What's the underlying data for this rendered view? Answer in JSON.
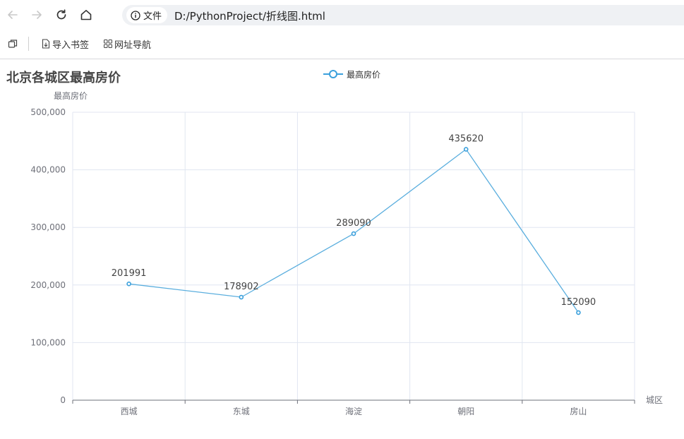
{
  "browser": {
    "back_icon": "arrow-left-icon",
    "forward_icon": "arrow-right-icon",
    "reload_icon": "reload-icon",
    "home_icon": "home-icon",
    "info_icon": "info-icon",
    "site_label": "文件",
    "url": "D:/PythonProject/折线图.html"
  },
  "bookmarks": {
    "tab_icon": "tab-group-icon",
    "items": [
      {
        "label": "导入书签",
        "icon": "import-icon"
      },
      {
        "label": "网址导航",
        "icon": "apps-grid-icon"
      }
    ]
  },
  "colors": {
    "series": "#5aaede",
    "marker": "#3ba0dc",
    "axis_text": "#6e7079",
    "grid": "#e0e6f1"
  },
  "chart_data": {
    "type": "line",
    "title": "北京各城区最高房价",
    "legend": [
      "最高房价"
    ],
    "legend_position": "top-center",
    "ylabel": "最高房价",
    "xlabel": "城区",
    "categories": [
      "西城",
      "东城",
      "海淀",
      "朝阳",
      "房山"
    ],
    "series": [
      {
        "name": "最高房价",
        "values": [
          201991,
          178902,
          289090,
          435620,
          152090
        ]
      }
    ],
    "ylim": [
      0,
      500000
    ],
    "yticks": [
      "0",
      "100,000",
      "200,000",
      "300,000",
      "400,000",
      "500,000"
    ],
    "grid": true,
    "data_labels": true
  }
}
